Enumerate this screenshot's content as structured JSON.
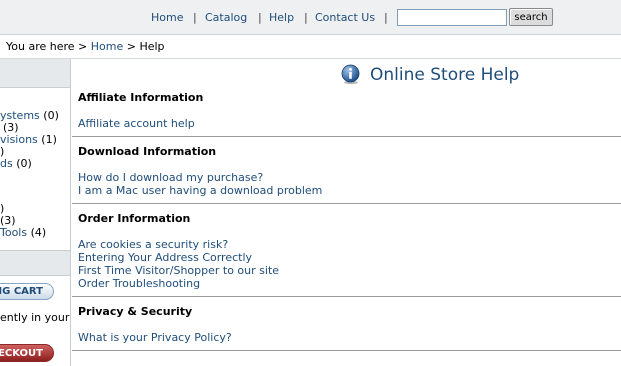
{
  "nav": {
    "home": "Home",
    "catalog": "Catalog",
    "help": "Help",
    "contact": "Contact Us",
    "separator": "|",
    "search_button": "search",
    "search_value": ""
  },
  "breadcrumb": {
    "prefix": "You are here >",
    "home": "Home",
    "separator": ">",
    "current": "Help"
  },
  "sidebar": {
    "categories": [
      {
        "label": "ystems",
        "count": "(0)"
      },
      {
        "label": "",
        "count": "(3)"
      },
      {
        "label": "visions",
        "count": "(1)"
      },
      {
        "label": "",
        "count": ")"
      },
      {
        "label": "ds",
        "count": "(0)"
      },
      {
        "label": "",
        "count": ")"
      },
      {
        "label": "",
        "count": "(3)"
      },
      {
        "label": "Tools",
        "count": "(4)"
      }
    ],
    "cart_button": "NG CART",
    "cart_status": "ently in your",
    "checkout_button": "HECKOUT"
  },
  "main": {
    "title": "Online Store Help",
    "sections": [
      {
        "title": "Affiliate Information",
        "links": [
          "Affiliate account help"
        ]
      },
      {
        "title": "Download Information",
        "links": [
          "How do I download my purchase?",
          "I am a Mac user having a download problem"
        ]
      },
      {
        "title": "Order Information",
        "links": [
          "Are cookies a security risk?",
          "Entering Your Address Correctly",
          "First Time Visitor/Shopper to our site",
          "Order Troubleshooting"
        ]
      },
      {
        "title": "Privacy & Security",
        "links": [
          "What is your Privacy Policy?"
        ]
      }
    ]
  },
  "colors": {
    "link": "#1f4d7a",
    "topbar": "#eef0f1",
    "checkout": "#8e1f1f"
  }
}
